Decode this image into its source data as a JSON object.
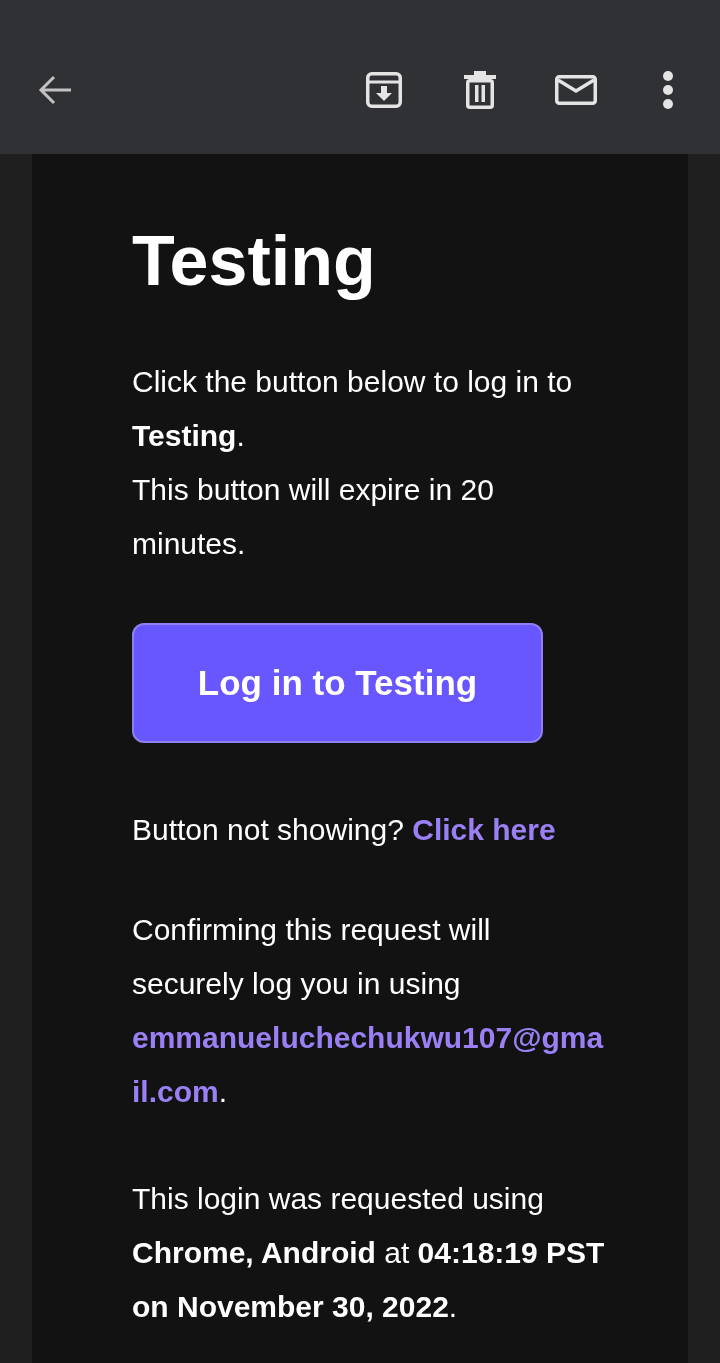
{
  "email": {
    "heading": "Testing",
    "intro": [
      "Click the button below to log in to **Testing**.",
      "This button will expire in 20 minutes."
    ],
    "login_button": "Log in to Testing",
    "fallback": {
      "text": "Button not showing?",
      "link": "Click here"
    },
    "confirmation": [
      {
        "kind": "plain",
        "text": "Confirming this request will securely log you in using "
      },
      {
        "kind": "accent",
        "text": "emmanueluchechukwu107@gmail.com"
      },
      {
        "kind": "plain",
        "text": "."
      }
    ],
    "request_info": "This login was requested using **Chrome, Android** at **04:18:19 PST on November 30, 2022**."
  }
}
